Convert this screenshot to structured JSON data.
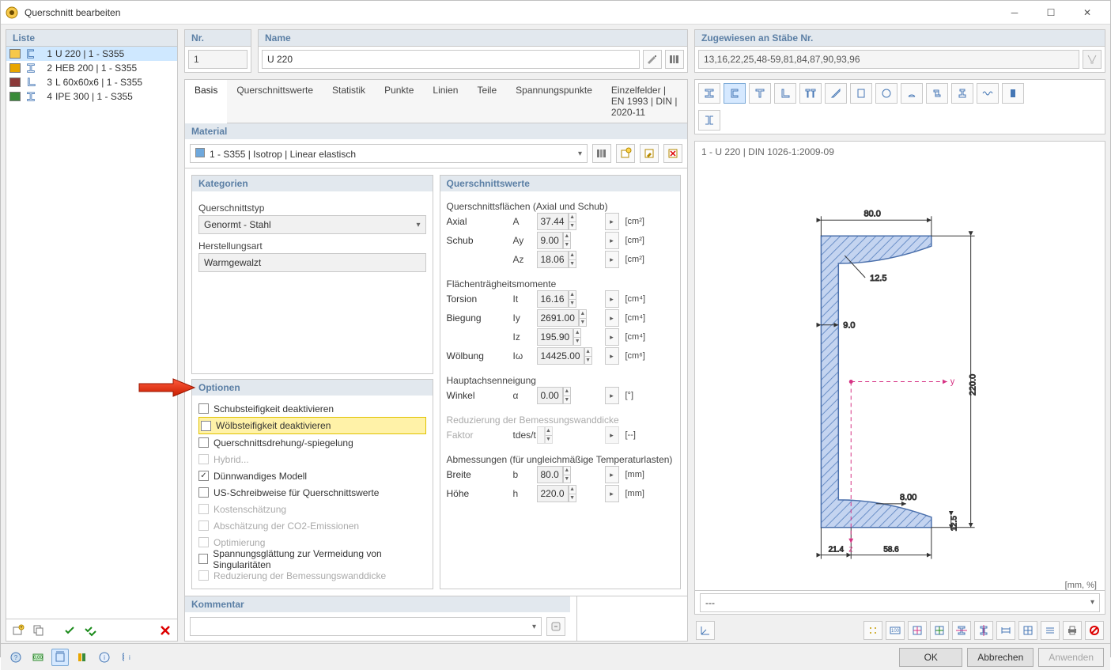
{
  "window": {
    "title": "Querschnitt bearbeiten"
  },
  "list_panel": {
    "header": "Liste",
    "items": [
      {
        "n": "1",
        "color": "#f6c84a",
        "label": "U 220 | 1 - S355",
        "shape": "U",
        "sel": true
      },
      {
        "n": "2",
        "color": "#e8a500",
        "label": "HEB 200 | 1 - S355",
        "shape": "I",
        "sel": false
      },
      {
        "n": "3",
        "color": "#8b3a3a",
        "label": "L 60x60x6 | 1 - S355",
        "shape": "L",
        "sel": false
      },
      {
        "n": "4",
        "color": "#3a8b3a",
        "label": "IPE 300 | 1 - S355",
        "shape": "I",
        "sel": false
      }
    ]
  },
  "nr": {
    "header": "Nr.",
    "value": "1"
  },
  "name": {
    "header": "Name",
    "value": "U 220"
  },
  "assigned": {
    "header": "Zugewiesen an Stäbe Nr.",
    "value": "13,16,22,25,48-59,81,84,87,90,93,96"
  },
  "tabs": [
    "Basis",
    "Querschnittswerte",
    "Statistik",
    "Punkte",
    "Linien",
    "Teile",
    "Spannungspunkte",
    "Einzelfelder | EN 1993 | DIN | 2020-11"
  ],
  "material": {
    "header": "Material",
    "value": "1 - S355 | Isotrop | Linear elastisch",
    "colors": {
      "swatch": "#6fa8dc"
    }
  },
  "categories": {
    "header": "Kategorien",
    "type_label": "Querschnittstyp",
    "type_value": "Genormt - Stahl",
    "manu_label": "Herstellungsart",
    "manu_value": "Warmgewalzt"
  },
  "options": {
    "header": "Optionen",
    "items": [
      {
        "label": "Schubsteifigkeit deaktivieren",
        "checked": false,
        "enabled": true
      },
      {
        "label": "Wölbsteifigkeit deaktivieren",
        "checked": false,
        "enabled": true,
        "highlight": true
      },
      {
        "label": "Querschnittsdrehung/-spiegelung",
        "checked": false,
        "enabled": true
      },
      {
        "label": "Hybrid...",
        "checked": false,
        "enabled": false
      },
      {
        "label": "Dünnwandiges Modell",
        "checked": true,
        "enabled": true
      },
      {
        "label": "US-Schreibweise für Querschnittswerte",
        "checked": false,
        "enabled": true
      },
      {
        "label": "Kostenschätzung",
        "checked": false,
        "enabled": false
      },
      {
        "label": "Abschätzung der CO2-Emissionen",
        "checked": false,
        "enabled": false
      },
      {
        "label": "Optimierung",
        "checked": false,
        "enabled": false
      },
      {
        "label": "Spannungsglättung zur Vermeidung von Singularitäten",
        "checked": false,
        "enabled": true
      },
      {
        "label": "Reduzierung der Bemessungswanddicke",
        "checked": false,
        "enabled": false
      }
    ]
  },
  "props": {
    "header": "Querschnittswerte",
    "areas": {
      "title": "Querschnittsflächen (Axial und Schub)",
      "rows": [
        {
          "name": "Axial",
          "sym": "A",
          "val": "37.44",
          "unit": "[cm²]"
        },
        {
          "name": "Schub",
          "sym": "Ay",
          "val": "9.00",
          "unit": "[cm²]"
        },
        {
          "name": "",
          "sym": "Az",
          "val": "18.06",
          "unit": "[cm²]"
        }
      ]
    },
    "inertia": {
      "title": "Flächenträgheitsmomente",
      "rows": [
        {
          "name": "Torsion",
          "sym": "It",
          "val": "16.16",
          "unit": "[cm⁴]"
        },
        {
          "name": "Biegung",
          "sym": "Iy",
          "val": "2691.00",
          "unit": "[cm⁴]"
        },
        {
          "name": "",
          "sym": "Iz",
          "val": "195.90",
          "unit": "[cm⁴]"
        },
        {
          "name": "Wölbung",
          "sym": "Iω",
          "val": "14425.00",
          "unit": "[cm⁶]"
        }
      ]
    },
    "axis": {
      "title": "Hauptachsenneigung",
      "rows": [
        {
          "name": "Winkel",
          "sym": "α",
          "val": "0.00",
          "unit": "[°]"
        }
      ]
    },
    "wall": {
      "title": "Reduzierung der Bemessungswanddicke",
      "rows": [
        {
          "name": "Faktor",
          "sym": "tdes/t",
          "val": "",
          "unit": "[--]",
          "disabled": true
        }
      ]
    },
    "dims": {
      "title": "Abmessungen (für ungleichmäßige Temperaturlasten)",
      "rows": [
        {
          "name": "Breite",
          "sym": "b",
          "val": "80.0",
          "unit": "[mm]"
        },
        {
          "name": "Höhe",
          "sym": "h",
          "val": "220.0",
          "unit": "[mm]"
        }
      ]
    }
  },
  "comment": {
    "header": "Kommentar"
  },
  "preview": {
    "caption": "1 - U 220 | DIN 1026-1:2009-09",
    "units": "[mm, %]",
    "dims": {
      "w": "80.0",
      "h": "220.0",
      "tf": "12.5",
      "tw": "9.0",
      "r": "8.00",
      "ez": "21.4",
      "ey": "58.6",
      "flange_tf": "12.5"
    },
    "sel": "---"
  },
  "footer": {
    "ok": "OK",
    "cancel": "Abbrechen",
    "apply": "Anwenden"
  },
  "chart_data": {
    "type": "table",
    "title": "U 220 | DIN 1026-1:2009-09 cross-section properties",
    "series": [
      {
        "name": "A [cm²]",
        "values": [
          37.44
        ]
      },
      {
        "name": "Ay [cm²]",
        "values": [
          9.0
        ]
      },
      {
        "name": "Az [cm²]",
        "values": [
          18.06
        ]
      },
      {
        "name": "It [cm⁴]",
        "values": [
          16.16
        ]
      },
      {
        "name": "Iy [cm⁴]",
        "values": [
          2691.0
        ]
      },
      {
        "name": "Iz [cm⁴]",
        "values": [
          195.9
        ]
      },
      {
        "name": "Iω [cm⁶]",
        "values": [
          14425.0
        ]
      },
      {
        "name": "α [°]",
        "values": [
          0.0
        ]
      },
      {
        "name": "b [mm]",
        "values": [
          80.0
        ]
      },
      {
        "name": "h [mm]",
        "values": [
          220.0
        ]
      },
      {
        "name": "tf [mm]",
        "values": [
          12.5
        ]
      },
      {
        "name": "tw [mm]",
        "values": [
          9.0
        ]
      }
    ]
  }
}
